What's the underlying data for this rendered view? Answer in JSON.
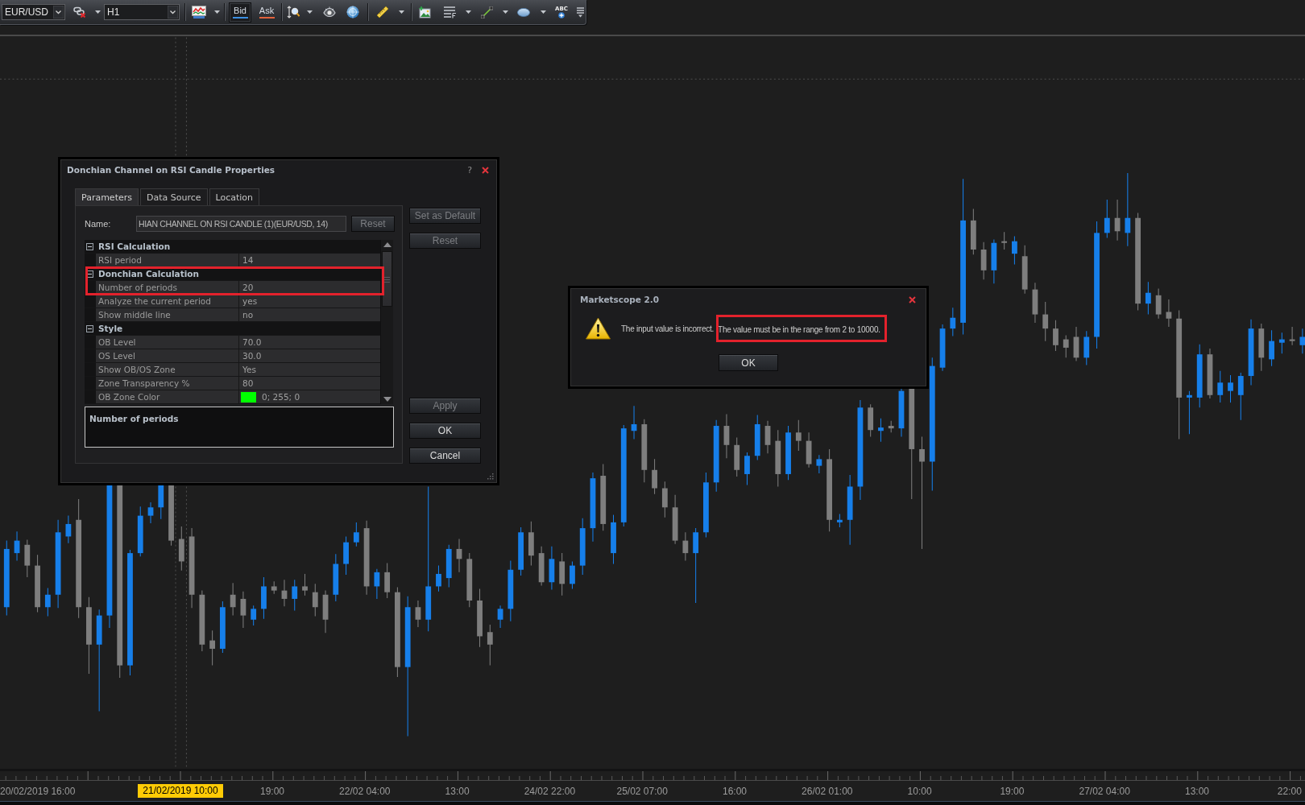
{
  "toolbar": {
    "symbol": "EUR/USD",
    "timeframe": "H1",
    "price_toggles": [
      {
        "label": "Bid",
        "selected": true,
        "color": "#3b8fe3"
      },
      {
        "label": "Ask",
        "selected": false,
        "color": "#e2623c"
      }
    ],
    "text_tool_label": "ABC"
  },
  "properties_dialog": {
    "title": "Donchian Channel on RSI Candle Properties",
    "help": "?",
    "tabs": [
      {
        "label": "Parameters",
        "selected": true
      },
      {
        "label": "Data Source",
        "selected": false
      },
      {
        "label": "Location",
        "selected": false
      }
    ],
    "name_label": "Name:",
    "name_value": "HIAN CHANNEL ON RSI CANDLE (1)(EUR/USD, 14)",
    "name_reset": {
      "label": "Reset",
      "disabled": true
    },
    "groups": [
      {
        "title": "RSI Calculation",
        "expanded": true,
        "annotated": false,
        "properties": [
          {
            "kind": "text",
            "name": "RSI period",
            "value": "14",
            "annotated": false
          }
        ]
      },
      {
        "title": "Donchian Calculation",
        "expanded": true,
        "annotated": true,
        "properties": [
          {
            "kind": "text",
            "name": "Number of periods",
            "value": "20",
            "annotated": true
          },
          {
            "kind": "text",
            "name": "Analyze the current period",
            "value": "yes",
            "annotated": false
          },
          {
            "kind": "text",
            "name": "Show middle line",
            "value": "no",
            "annotated": false
          }
        ]
      },
      {
        "title": "Style",
        "expanded": true,
        "annotated": false,
        "properties": [
          {
            "kind": "text",
            "name": "OB Level",
            "value": "70.0",
            "annotated": false
          },
          {
            "kind": "text",
            "name": "OS Level",
            "value": "30.0",
            "annotated": false
          },
          {
            "kind": "text",
            "name": "Show OB/OS Zone",
            "value": "Yes",
            "annotated": false
          },
          {
            "kind": "text",
            "name": "Zone Transparency %",
            "value": "80",
            "annotated": false
          },
          {
            "kind": "color",
            "name": "OB Zone Color",
            "value": "0; 255; 0",
            "color": "#00ff00",
            "annotated": false
          }
        ]
      }
    ],
    "description": "Number of periods",
    "side_buttons": [
      {
        "label": "Set as Default",
        "disabled": true
      },
      {
        "label": "Reset",
        "disabled": true
      }
    ],
    "action_buttons": [
      {
        "label": "Apply",
        "disabled": true
      },
      {
        "label": "OK",
        "disabled": false
      },
      {
        "label": "Cancel",
        "disabled": false
      }
    ]
  },
  "message_dialog": {
    "title": "Marketscope 2.0",
    "message": [
      {
        "text": "The input value is incorrect.",
        "annotated": false
      },
      {
        "text": "The value must be in the range from 2 to 10000.",
        "annotated": true
      }
    ],
    "button": "OK"
  },
  "time_axis": {
    "labels": [
      "20/02/2019 16:00",
      "19:00",
      "22/02 04:00",
      "13:00",
      "24/02 22:00",
      "25/02 07:00",
      "16:00",
      "26/02 01:00",
      "10:00",
      "19:00",
      "27/02 04:00",
      "13:00",
      "22:00"
    ],
    "crosshair_label": "21/02/2019 10:00"
  }
}
